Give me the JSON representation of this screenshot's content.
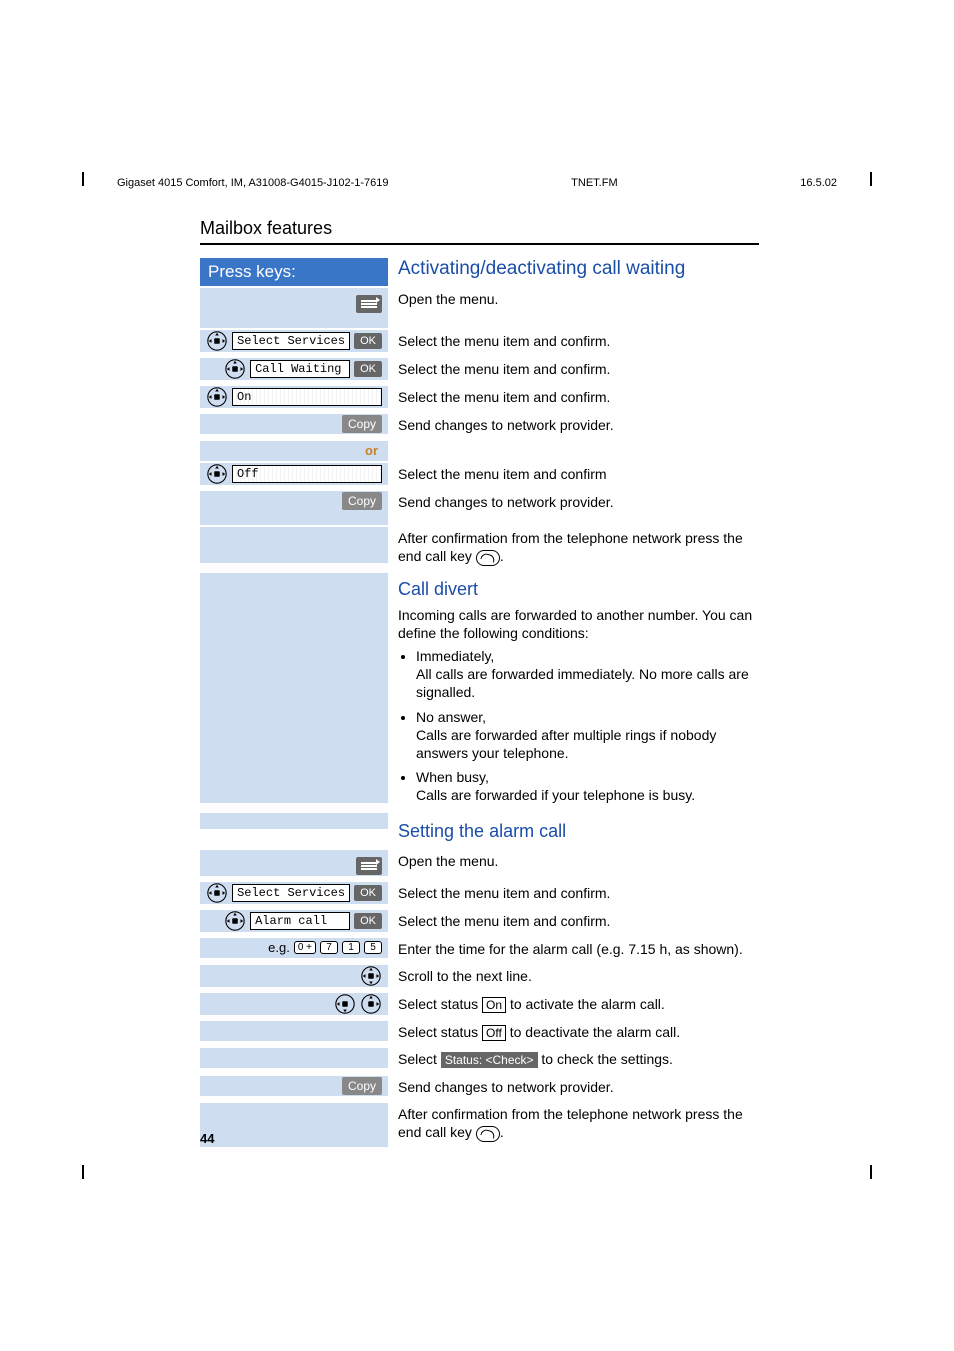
{
  "header": {
    "left": "Gigaset 4015 Comfort, IM, A31008-G4015-J102-1-7619",
    "mid": "TNET.FM",
    "right": "16.5.02"
  },
  "section_title": "Mailbox features",
  "press_keys": "Press keys:",
  "or_label": "or",
  "eg_label": "e.g.",
  "keys": {
    "k0": "0 +",
    "k7": "7",
    "k1": "1",
    "k5": "5"
  },
  "ok": "OK",
  "copy": "Copy",
  "menu": {
    "select_services": "Select Services",
    "call_waiting": "Call Waiting",
    "on": "On",
    "off": "Off",
    "alarm_call": "Alarm call"
  },
  "h1": "Activating/deactivating call waiting",
  "steps1": {
    "open_menu": "Open the menu.",
    "select_confirm": "Select the menu item and confirm.",
    "send_changes": "Send changes to network provider.",
    "select_confirm_noperiod": "Select the menu item and confirm",
    "after_confirm_part1": "After confirmation from the telephone network press the end call key ",
    "after_confirm_part2": "."
  },
  "h2": "Call divert",
  "divert_intro": "Incoming calls are forwarded to another number. You can define the following conditions:",
  "divert": {
    "b1_label": "Immediately,",
    "b1_desc": "All calls are forwarded immediately. No more calls are signalled.",
    "b2_label": "No answer,",
    "b2_desc": "Calls are forwarded after multiple rings if nobody answers your telephone.",
    "b3_label": "When busy,",
    "b3_desc": "Calls are forwarded if your telephone is busy."
  },
  "h3": "Setting the alarm call",
  "alarm": {
    "enter_time": "Enter the time for the alarm call (e.g. 7.15 h, as shown).",
    "scroll": "Scroll to the next line.",
    "sel_on_pre": "Select status ",
    "sel_on_box": "On",
    "sel_on_post": " to activate the alarm call.",
    "sel_off_pre": "Select status ",
    "sel_off_box": "Off",
    "sel_off_post": " to deactivate the alarm call.",
    "sel_check_pre": "Select ",
    "sel_check_box": "Status: <Check>",
    "sel_check_post": " to check the settings."
  },
  "page_number": "44"
}
